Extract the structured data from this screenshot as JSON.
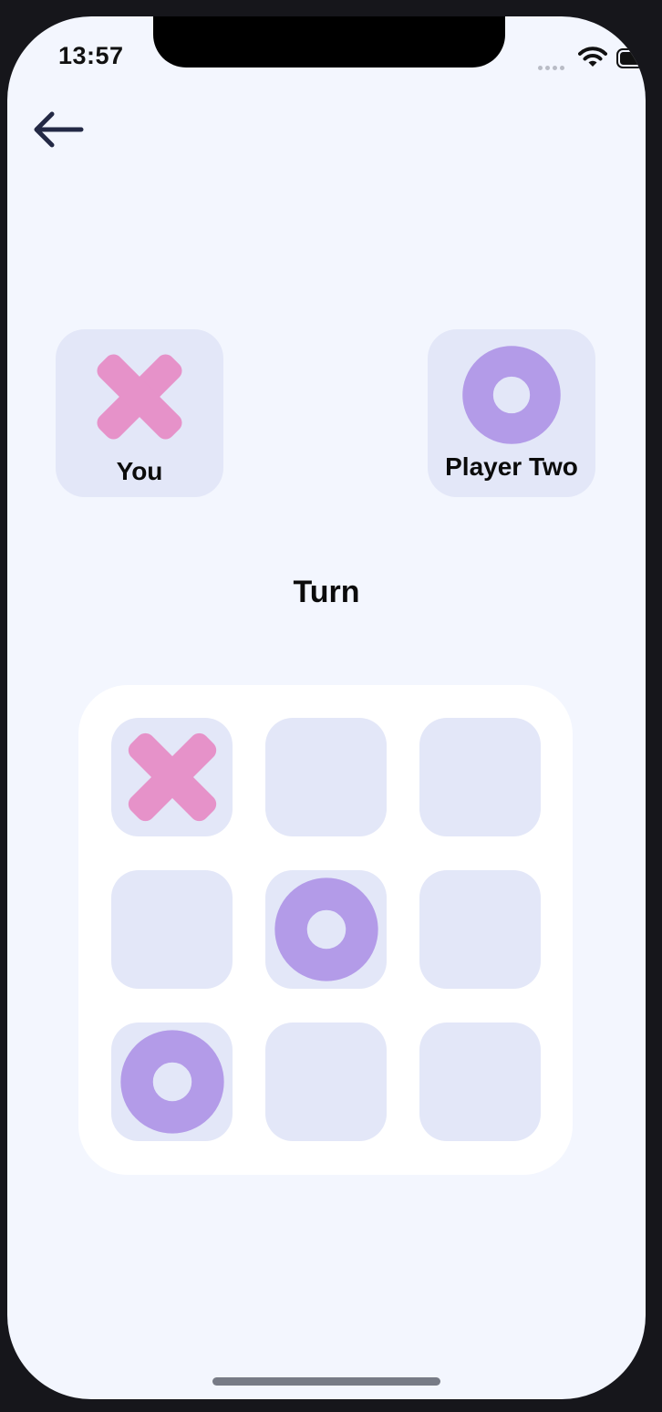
{
  "status_bar": {
    "time": "13:57"
  },
  "players": [
    {
      "name": "You",
      "mark": "x-icon"
    },
    {
      "name": "Player Two",
      "mark": "o-icon"
    }
  ],
  "turn_label": "Turn",
  "board": {
    "cells": [
      "X",
      "",
      "",
      "",
      "O",
      "",
      "O",
      "",
      ""
    ]
  },
  "colors": {
    "background": "#f3f6fe",
    "card": "#e3e7f8",
    "x_mark": "#e692c9",
    "o_mark": "#b39be8"
  },
  "icons": {
    "back": "arrow-left-icon",
    "wifi": "wifi-icon",
    "battery": "battery-icon"
  }
}
